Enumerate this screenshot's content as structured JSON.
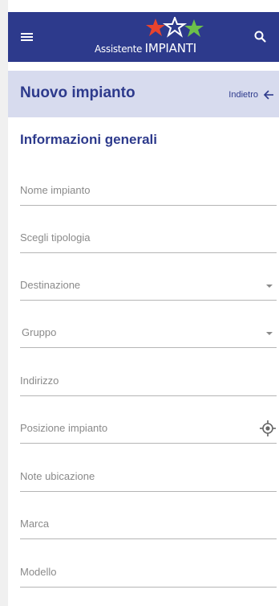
{
  "appbar": {
    "logo_text_small": "Assistente",
    "logo_text_big": "IMPIANTI",
    "background": "#2d3a8c",
    "icons": {
      "menu": "menu-icon",
      "search": "search-icon",
      "logo": "stars-logo"
    }
  },
  "subheader": {
    "title": "Nuovo impianto",
    "back_label": "Indietro",
    "back_icon": "arrow-left-icon",
    "background": "#d7dbee"
  },
  "section": {
    "title": "Informazioni generali"
  },
  "form": {
    "fields": [
      {
        "label": "Nome impianto",
        "type": "text"
      },
      {
        "label": "Scegli tipologia",
        "type": "text"
      },
      {
        "label": "Destinazione",
        "type": "select",
        "icon": "chevron-down-icon"
      },
      {
        "label": "Gruppo",
        "type": "select",
        "icon": "chevron-down-icon"
      },
      {
        "label": "Indirizzo",
        "type": "text"
      },
      {
        "label": "Posizione impianto",
        "type": "text",
        "icon": "gps-target-icon"
      },
      {
        "label": "Note ubicazione",
        "type": "text"
      },
      {
        "label": "Marca",
        "type": "text"
      },
      {
        "label": "Modello",
        "type": "text"
      }
    ]
  },
  "colors": {
    "accent": "#2d3a8c",
    "label": "#8a8a8a",
    "divider": "#b5b5b5",
    "logo_red": "#e8432d",
    "logo_green": "#6cc04a"
  }
}
